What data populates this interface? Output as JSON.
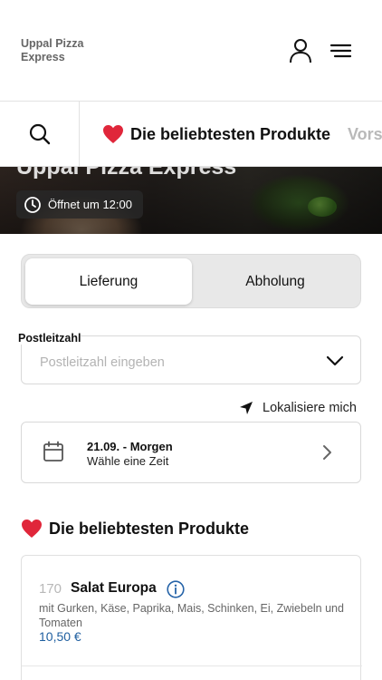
{
  "header": {
    "brand_line1": "Uppal Pizza",
    "brand_line2": "Express",
    "user_icon": "user-icon",
    "menu_icon": "hamburger-menu-icon"
  },
  "categories": {
    "search_icon": "search-icon",
    "items": [
      {
        "label": "Die beliebtesten Produkte",
        "icon": "heart-icon",
        "active": true
      },
      {
        "label": "Vors",
        "active": false
      }
    ]
  },
  "hero": {
    "title": "Uppal Pizza Express",
    "hours": "Öffnet um 12:00",
    "hours_icon": "clock-icon"
  },
  "delivery_toggle": {
    "options": [
      "Lieferung",
      "Abholung"
    ],
    "selected": "Lieferung"
  },
  "postal": {
    "label": "Postleitzahl",
    "value": "",
    "placeholder": "Postleitzahl eingeben",
    "icon": "chevron-down-icon"
  },
  "locate": {
    "label": "Lokalisiere mich",
    "icon": "location-arrow-icon"
  },
  "date": {
    "main": "21.09. - Morgen",
    "sub": "Wähle eine Zeit",
    "icon": "calendar-icon",
    "chevron": "chevron-right-icon"
  },
  "section": {
    "title": "Die beliebtesten Produkte",
    "icon": "heart-icon"
  },
  "products": [
    {
      "number": "170",
      "name": "Salat Europa",
      "description": "mit Gurken, Käse, Paprika, Mais, Schinken, Ei, Zwiebeln und Tomaten",
      "price": "10,50 €",
      "info_icon": "info-icon"
    }
  ],
  "colors": {
    "heart": "#e0263a",
    "price": "#1f5fa0",
    "info": "#2563a8",
    "inactive_tab": "#b9b9b9"
  }
}
